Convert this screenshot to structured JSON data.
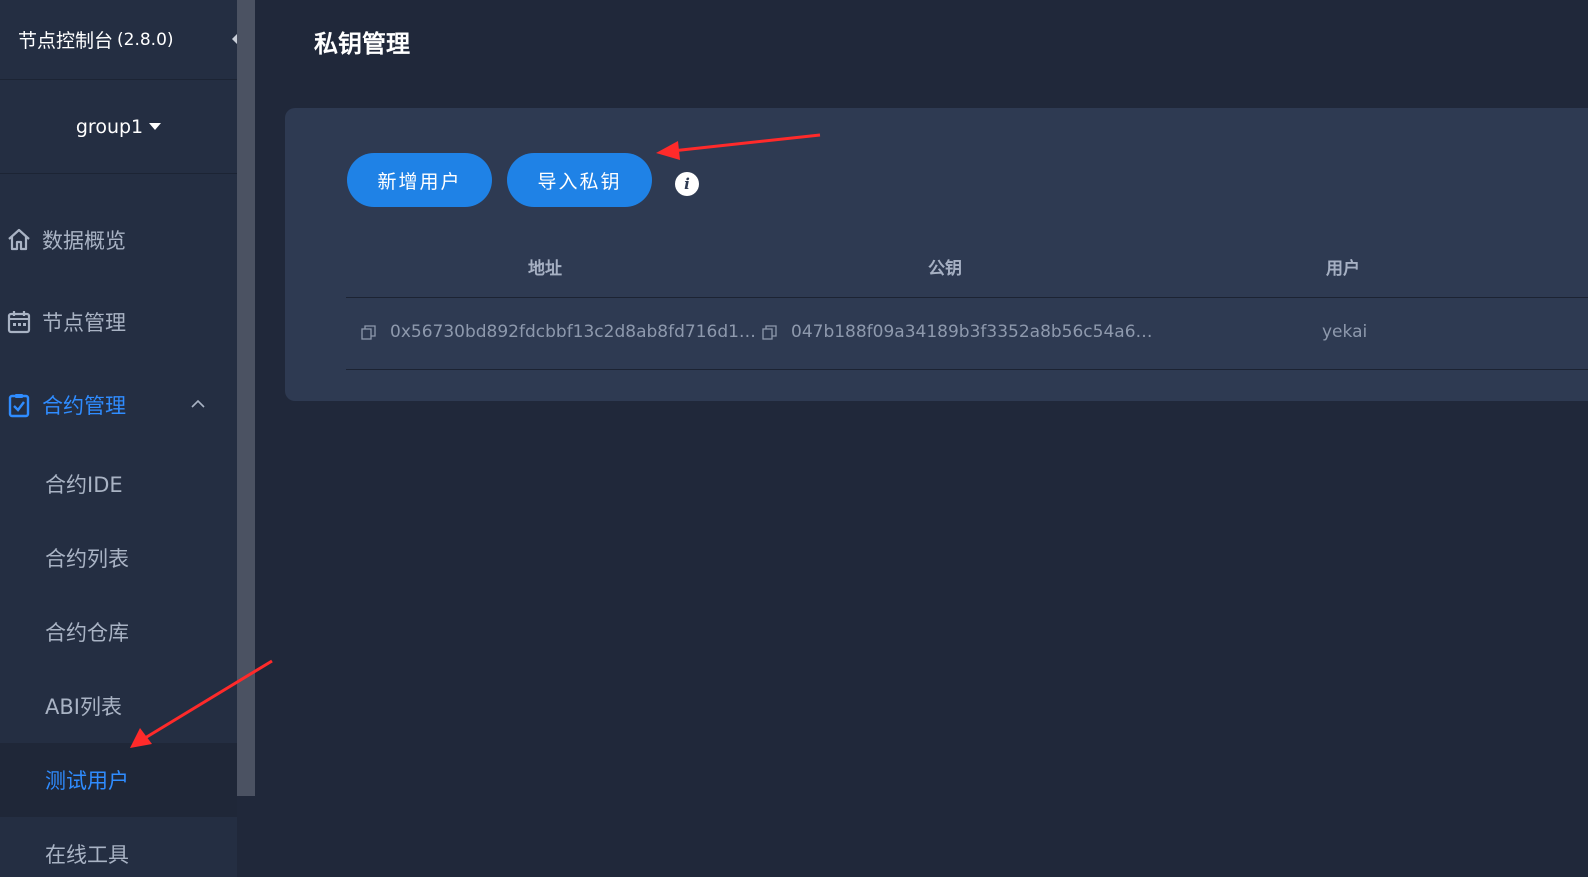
{
  "brand": {
    "title": "节点控制台",
    "version": "(2.8.0)"
  },
  "group_selector": {
    "value": "group1"
  },
  "nav": {
    "overview": "数据概览",
    "node_mgmt": "节点管理",
    "contract_mgmt": "合约管理",
    "sub_items": [
      "合约IDE",
      "合约列表",
      "合约仓库",
      "ABI列表",
      "测试用户",
      "在线工具"
    ]
  },
  "main": {
    "page_title": "私钥管理",
    "buttons": {
      "add_user": "新增用户",
      "import_key": "导入私钥"
    },
    "table": {
      "headers": [
        "地址",
        "公钥",
        "用户"
      ],
      "rows": [
        {
          "address": "0x56730bd892fdcbbf13c2d8ab8fd716d1…",
          "public_key": "047b188f09a34189b3f3352a8b56c54a6…",
          "user": "yekai"
        }
      ]
    }
  },
  "colors": {
    "accent": "#2f8cff",
    "button": "#1f82e6",
    "annotation": "#ff2a2a"
  },
  "icons": [
    "home-icon",
    "calendar-icon",
    "clipboard-icon",
    "chevron-up-icon",
    "info-icon",
    "copy-icon",
    "caret-down-icon"
  ]
}
